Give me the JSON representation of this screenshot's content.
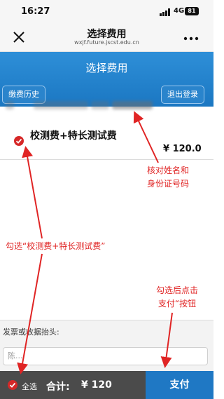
{
  "status_bar": {
    "time": "16:27",
    "network": "4G",
    "battery": "81"
  },
  "title_bar": {
    "title": "选择费用",
    "url": "wxjf.future.jscst.edu.cn",
    "close_icon": "close-icon",
    "more_icon": "more-icon"
  },
  "header": {
    "title": "选择费用",
    "history_button": "缴费历史",
    "logout_button": "退出登录",
    "background": "#1b77c2"
  },
  "item": {
    "name": "校测费+特长测试费",
    "price": "¥ 120.0",
    "checked": true
  },
  "annotations": {
    "verify_line1": "核对姓名和",
    "verify_line2": "身份证号码",
    "select_item": "勾选“校测费+特长测试费”",
    "pay_line1": "勾选后点击",
    "pay_line2": "支付“按钮",
    "color": "#e02424"
  },
  "invoice": {
    "label": "发票或收据抬头:",
    "value": "陈..."
  },
  "bottom_bar": {
    "select_all": "全选",
    "total_label": "合计:",
    "total_value": "¥ 120",
    "pay_button": "支付"
  }
}
